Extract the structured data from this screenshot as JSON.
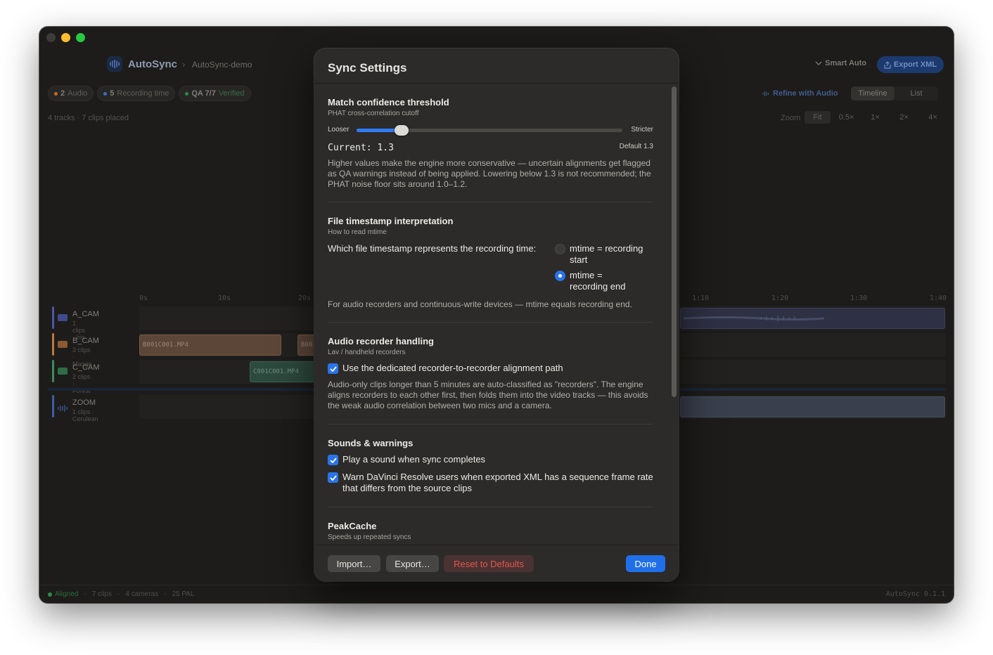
{
  "app": {
    "name": "AutoSync",
    "project": "AutoSync-demo",
    "smart_auto": "Smart Auto",
    "export_xml": "Export XML"
  },
  "badges": [
    {
      "count": "2",
      "label": "Audio",
      "color": "#c96a1f"
    },
    {
      "count": "5",
      "label": "Recording time",
      "color": "#3a6bc2"
    },
    {
      "count": "QA 7/7",
      "label": "Verified",
      "color": "#2f8a47"
    }
  ],
  "toolbar": {
    "refine": "Refine with Audio",
    "view_timeline": "Timeline",
    "view_list": "List",
    "tracks_summary": "4 tracks · 7 clips placed",
    "zoom_label": "Zoom",
    "zoom_options": [
      "Fit",
      "0.5×",
      "1×",
      "2×",
      "4×"
    ]
  },
  "ruler": [
    "0s",
    "10s",
    "20s",
    "1:10",
    "1:20",
    "1:30",
    "1:40"
  ],
  "tracks": [
    {
      "name": "A_CAM",
      "sub": "1 clips · Iris",
      "color": "#4c56a3"
    },
    {
      "name": "B_CAM",
      "sub": "3 clips · Mango",
      "color": "#b9773f"
    },
    {
      "name": "C_CAM",
      "sub": "2 clips · Forest",
      "color": "#3e8a5b"
    },
    {
      "name": "ZOOM",
      "sub": "1 clips · Cerulean",
      "color": "#3d5ea8"
    }
  ],
  "clips": {
    "b1": "B001C001.MP4",
    "b2": "B00",
    "c1": "C001C001.MP4"
  },
  "status": {
    "state": "Aligned",
    "clips": "7 clips",
    "cameras": "4 cameras",
    "fps": "25 PAL",
    "version": "AutoSync 0.1.1"
  },
  "modal": {
    "title": "Sync Settings",
    "threshold": {
      "title": "Match confidence threshold",
      "subtitle": "PHAT cross-correlation cutoff",
      "left": "Looser",
      "right": "Stricter",
      "value_fraction": 0.17,
      "current": "Current: 1.3",
      "default": "Default 1.3",
      "description": "Higher values make the engine more conservative — uncertain alignments get flagged as QA warnings instead of being applied. Lowering below 1.3 is not recommended; the PHAT noise floor sits around 1.0–1.2."
    },
    "timestamp": {
      "title": "File timestamp interpretation",
      "subtitle": "How to read mtime",
      "question": "Which file timestamp represents the recording time:",
      "option_start": "mtime = recording start",
      "option_end": "mtime = recording end",
      "selected": "end",
      "description": "For audio recorders and continuous-write devices — mtime equals recording end."
    },
    "audio": {
      "title": "Audio recorder handling",
      "subtitle": "Lav / handheld recorders",
      "checkbox": "Use the dedicated recorder-to-recorder alignment path",
      "checked": true,
      "description": "Audio-only clips longer than 5 minutes are auto-classified as \"recorders\". The engine aligns recorders to each other first, then folds them into the video tracks — this avoids the weak audio correlation between two mics and a camera."
    },
    "sounds": {
      "title": "Sounds & warnings",
      "check_sound": "Play a sound when sync completes",
      "check_warn": "Warn DaVinci Resolve users when exported XML has a sequence frame rate that differs from the source clips"
    },
    "peakcache": {
      "title": "PeakCache",
      "subtitle": "Speeds up repeated syncs"
    },
    "buttons": {
      "import": "Import…",
      "export": "Export…",
      "reset": "Reset to Defaults",
      "done": "Done"
    }
  }
}
